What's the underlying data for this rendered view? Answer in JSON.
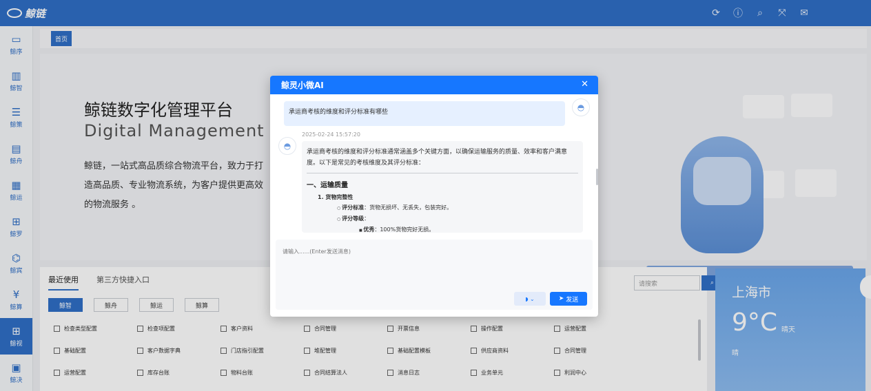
{
  "topbar": {
    "logo_text": "鲸链",
    "icons": [
      "refresh-icon",
      "help-icon",
      "search-icon",
      "fullscreen-icon",
      "mail-icon"
    ]
  },
  "sidebar": {
    "items": [
      {
        "label": "鲸序",
        "icon": "monitor-icon"
      },
      {
        "label": "鲸智",
        "icon": "chip-icon"
      },
      {
        "label": "鲸策",
        "icon": "list-icon"
      },
      {
        "label": "鲸舟",
        "icon": "clipboard-icon"
      },
      {
        "label": "鲸运",
        "icon": "document-icon"
      },
      {
        "label": "鲸罗",
        "icon": "grid-icon"
      },
      {
        "label": "鲸宾",
        "icon": "user-search-icon"
      },
      {
        "label": "鲸算",
        "icon": "yen-icon"
      },
      {
        "label": "鲸视",
        "icon": "apps-icon"
      },
      {
        "label": "鲸决",
        "icon": "file-check-icon"
      }
    ],
    "active_index": 8
  },
  "tabs": {
    "home": "首页"
  },
  "hero": {
    "title": "鲸链数字化管理平台",
    "subtitle": "Digital Management Pla",
    "description": "鲸链，一站式高品质综合物流平台，致力于打造高品质、专业物流系统，为客户提供更高效的物流服务 。"
  },
  "quick": {
    "tabs": [
      "最近使用",
      "第三方快捷入口"
    ],
    "chips": [
      "鲸智",
      "鲸舟",
      "鲸运",
      "鲸算"
    ],
    "search_placeholder": "请搜索",
    "search_button": "搜索",
    "items": [
      "检查类型配置",
      "检查项配置",
      "客户资料",
      "合同管理",
      "开票信息",
      "操作配置",
      "运营配置",
      "基础配置",
      "客户数据字典",
      "门店指引配置",
      "堆配管理",
      "基础配置模板",
      "供应商资料",
      "合同管理",
      "运营配置",
      "库存台账",
      "物料台账",
      "合同结算法人",
      "消息日志",
      "业务单元",
      "利润中心"
    ]
  },
  "weather": {
    "city": "上海市",
    "temperature": "9°C",
    "condition": "晴天",
    "condition2": "晴"
  },
  "chat": {
    "title": "鲸灵小微AI",
    "user_message": "承运商考核的维度和评分标准有哪些",
    "timestamp": "2025-02-24 15:57:20",
    "ai_intro": "承运商考核的维度和评分标准通常涵盖多个关键方面，以确保运输服务的质量、效率和客户满意度。以下是常见的考核维度及其评分标准：",
    "section1": "一、运输质量",
    "item1": "1. 货物完整性",
    "item1_std_label": "评分标准",
    "item1_std_text": "：货物无损坏、无丢失，包装完好。",
    "item1_grade_label": "评分等级",
    "item1_grade_suffix": "：",
    "item1_excellent_label": "优秀",
    "item1_excellent_text": "：100%货物完好无损。",
    "input_placeholder": "请输入......(Enter发送消息)",
    "send_label": "发送"
  }
}
